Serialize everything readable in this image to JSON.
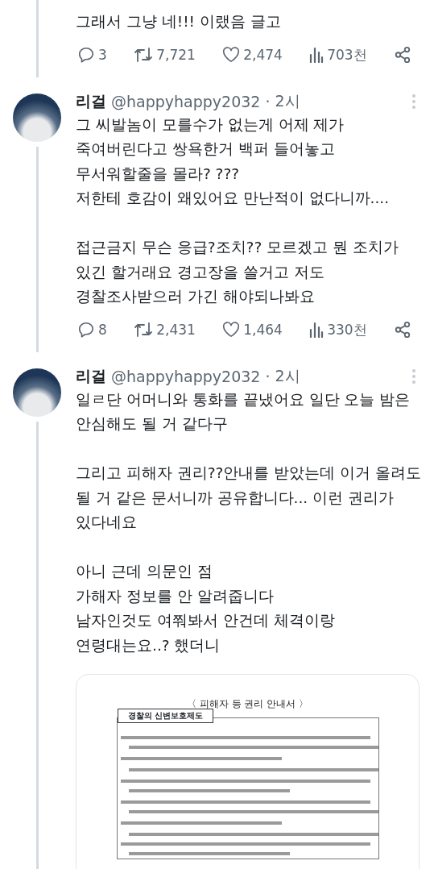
{
  "tweets": [
    {
      "paragraphs": [
        [
          "그래서 그냥 네!!! 이랬음 글고"
        ]
      ],
      "actions": {
        "replies": "3",
        "retweets": "7,721",
        "likes": "2,474",
        "views": "703천"
      }
    },
    {
      "name": "리걸",
      "handle": "@happyhappy2032",
      "separator": "·",
      "time": "2시",
      "paragraphs": [
        [
          "그 씨발놈이 모를수가 없는게 어제 제가",
          "죽여버린다고 쌍욕한거 백퍼 들어놓고",
          "무서워할줄을 몰라? ???",
          "저한테 호감이 왜있어요 만난적이 없다니까...."
        ],
        [
          "접근금지 무슨 응급?조치?? 모르겠고 뭔 조치가",
          "있긴 할거래요 경고장을 쓸거고 저도",
          "경찰조사받으러 가긴 해야되나봐요"
        ]
      ],
      "actions": {
        "replies": "8",
        "retweets": "2,431",
        "likes": "1,464",
        "views": "330천"
      }
    },
    {
      "name": "리걸",
      "handle": "@happyhappy2032",
      "separator": "·",
      "time": "2시",
      "paragraphs": [
        [
          "일ㄹ단 어머니와 통화를 끝냈어요 일단 오늘 밤은",
          "안심해도 될 거 같다구"
        ],
        [
          "그리고 피해자 권리??안내를 받았는데 이거 올려도",
          "될 거 같은 문서니까 공유합니다... 이런 권리가",
          "있다네요"
        ],
        [
          "아니 근데 의문인 점",
          "가해자 정보를 안 알려줍니다",
          "남자인것도 여쭤봐서 안건데 체격이랑",
          "연령대는요..? 했더니"
        ]
      ],
      "attachment": {
        "title": "〈 피해자 등 권리 안내서 〉",
        "section": "경찰의 신변보호제도"
      }
    }
  ]
}
